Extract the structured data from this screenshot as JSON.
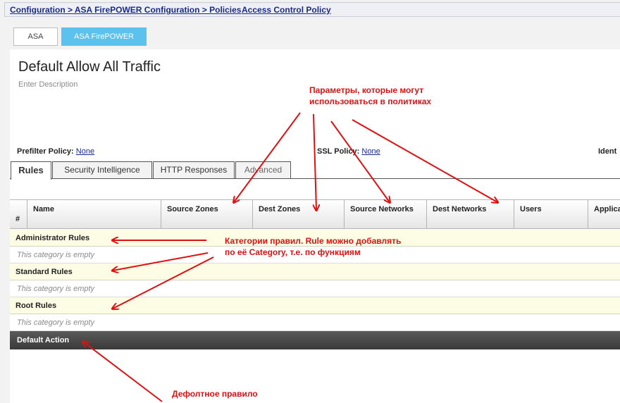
{
  "breadcrumb": {
    "path": "Configuration > ASA FirePOWER Configuration > Policies",
    "separator": ">",
    "current": "Access Control Policy"
  },
  "device_tabs": [
    "ASA",
    "ASA FirePOWER"
  ],
  "policy": {
    "title": "Default Allow All Traffic",
    "description_placeholder": "Enter Description"
  },
  "policy_settings": {
    "prefilter_label": "Prefilter Policy:",
    "prefilter_value": "None",
    "ssl_label": "SSL Policy:",
    "ssl_value": "None",
    "identity_label": "Ident"
  },
  "policy_tabs": [
    "Rules",
    "Security Intelligence",
    "HTTP Responses",
    "Advanced"
  ],
  "rule_table": {
    "columns": [
      "#",
      "Name",
      "Source Zones",
      "Dest Zones",
      "Source Networks",
      "Dest Networks",
      "Users",
      "Applica"
    ],
    "categories": [
      {
        "name": "Administrator Rules",
        "empty_text": "This category is empty"
      },
      {
        "name": "Standard Rules",
        "empty_text": "This category is empty"
      },
      {
        "name": "Root Rules",
        "empty_text": "This category is empty"
      }
    ],
    "default_action_label": "Default Action"
  },
  "annotations": {
    "params_line1": "Параметры, которые могут",
    "params_line2": "использоваться в политиках",
    "categories_line1": "Категории правил. Rule можно добавлять",
    "categories_line2": "по её Category, т.е. по функциям",
    "default_rule": "Дефолтное правило"
  },
  "colors": {
    "accent_tab": "#5bc2ee",
    "annotation_red": "#e01010",
    "link_blue": "#1a2a8c",
    "category_row": "#fdfde6",
    "default_action_bar": "#444444"
  }
}
